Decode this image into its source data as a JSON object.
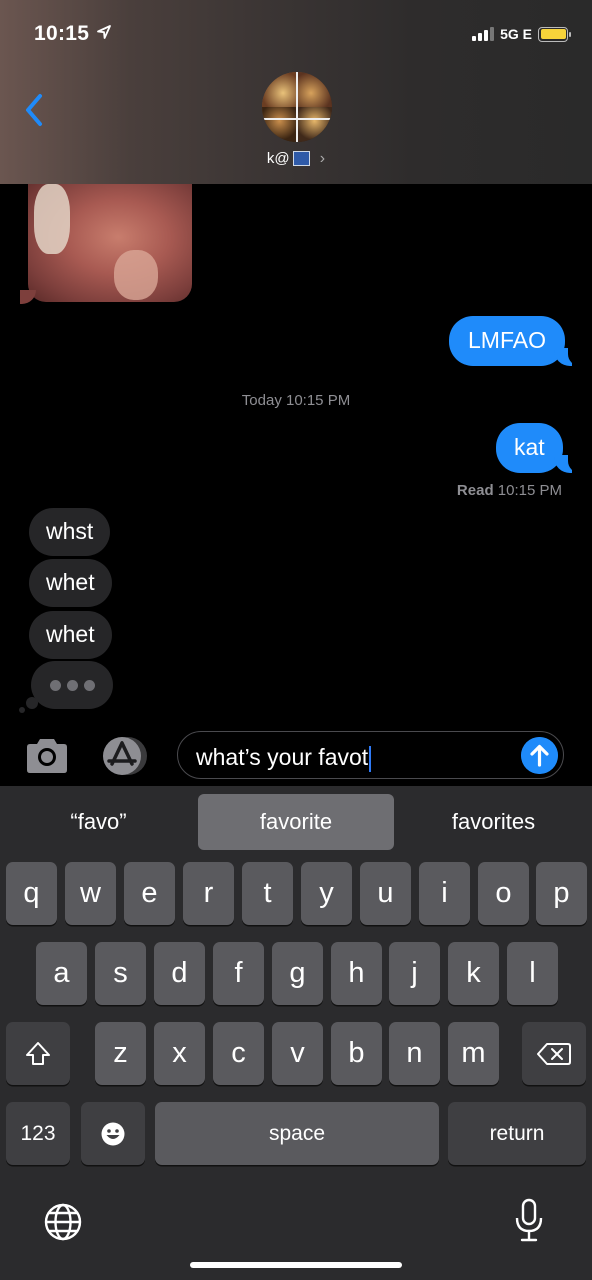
{
  "status_bar": {
    "time": "10:15",
    "network": "5G E",
    "location_icon": "location-arrow-icon",
    "battery_color": "#f7d33a"
  },
  "header": {
    "contact_name": "k@",
    "back_icon": "chevron-left-icon",
    "accent": "#1f8bfa"
  },
  "messages": {
    "sent_1": "LMFAO",
    "timestamp": "Today 10:15 PM",
    "sent_2": "kat",
    "read_label": "Read",
    "read_time": "10:15 PM",
    "received": [
      "whst",
      "whet",
      "whet"
    ]
  },
  "composer": {
    "text": "what’s your favot",
    "camera_icon": "camera-icon",
    "appstore_icon": "app-store-icon",
    "send_icon": "arrow-up-icon"
  },
  "keyboard": {
    "suggestions": [
      "“favo”",
      "favorite",
      "favorites"
    ],
    "row1": [
      "q",
      "w",
      "e",
      "r",
      "t",
      "y",
      "u",
      "i",
      "o",
      "p"
    ],
    "row2": [
      "a",
      "s",
      "d",
      "f",
      "g",
      "h",
      "j",
      "k",
      "l"
    ],
    "row3": [
      "z",
      "x",
      "c",
      "v",
      "b",
      "n",
      "m"
    ],
    "numbers_label": "123",
    "space_label": "space",
    "return_label": "return",
    "emoji_icon": "emoji-icon",
    "shift_icon": "shift-icon",
    "delete_icon": "delete-icon",
    "globe_icon": "globe-icon",
    "mic_icon": "microphone-icon"
  }
}
